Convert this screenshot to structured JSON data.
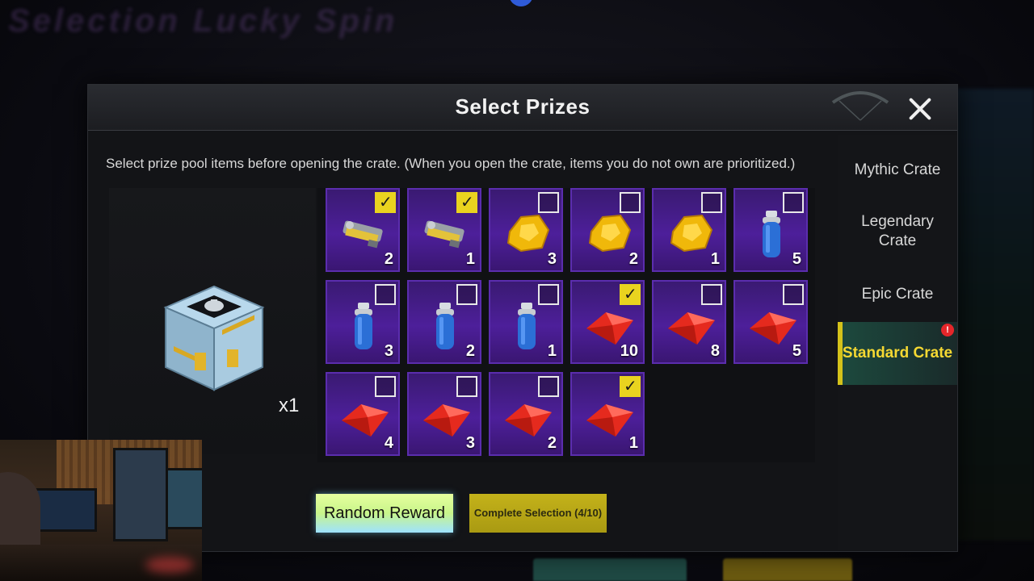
{
  "background": {
    "title": "Selection Lucky Spin"
  },
  "dialog": {
    "title": "Select Prizes",
    "instructions": "Select prize pool items before opening the crate. (When you open the crate, items you do not own are prioritized.)",
    "crate_quantity": "x1"
  },
  "sidebar": {
    "items": [
      {
        "label": "Mythic Crate",
        "active": false
      },
      {
        "label": "Legendary Crate",
        "active": false
      },
      {
        "label": "Epic Crate",
        "active": false
      },
      {
        "label": "Standard Crate",
        "active": true,
        "badge": "!"
      }
    ]
  },
  "prizes": [
    {
      "icon": "gun-parts-icon",
      "count": "2",
      "checked": true
    },
    {
      "icon": "gun-parts-icon",
      "count": "1",
      "checked": true
    },
    {
      "icon": "gold-nugget-icon",
      "count": "3",
      "checked": false
    },
    {
      "icon": "gold-nugget-icon",
      "count": "2",
      "checked": false
    },
    {
      "icon": "gold-nugget-icon",
      "count": "1",
      "checked": false
    },
    {
      "icon": "spray-can-icon",
      "count": "5",
      "checked": false
    },
    {
      "icon": "spray-can-icon",
      "count": "3",
      "checked": false
    },
    {
      "icon": "spray-can-icon",
      "count": "2",
      "checked": false
    },
    {
      "icon": "spray-can-icon",
      "count": "1",
      "checked": false
    },
    {
      "icon": "red-gem-icon",
      "count": "10",
      "checked": true
    },
    {
      "icon": "red-gem-icon",
      "count": "8",
      "checked": false
    },
    {
      "icon": "red-gem-icon",
      "count": "5",
      "checked": false
    },
    {
      "icon": "red-gem-icon",
      "count": "4",
      "checked": false
    },
    {
      "icon": "red-gem-icon",
      "count": "3",
      "checked": false
    },
    {
      "icon": "red-gem-icon",
      "count": "2",
      "checked": false
    },
    {
      "icon": "red-gem-icon",
      "count": "1",
      "checked": true
    }
  ],
  "buttons": {
    "random": "Random Reward",
    "complete": "Complete Selection (4/10)"
  },
  "colors": {
    "accent_yellow": "#e9d31f",
    "tile_purple": "#4d1f9a",
    "active_tab_text": "#f5d832"
  }
}
